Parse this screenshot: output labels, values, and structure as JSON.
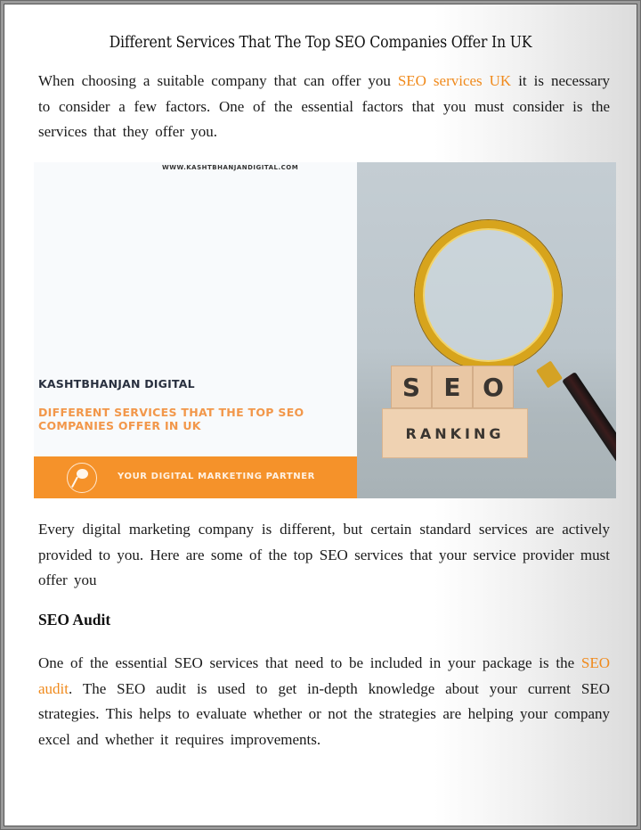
{
  "document": {
    "title": "Different Services That The Top SEO Companies Offer In UK",
    "intro": {
      "before": "When choosing a suitable company that can offer you ",
      "link": "SEO services UK",
      "after": " it is necessary to consider a few factors. One of the essential factors that you must consider is the services that they offer you."
    },
    "paragraph2": "Every digital marketing company is different, but certain standard services are actively provided to you. Here are some of the top SEO services that your service provider must offer you",
    "section_heading": "SEO Audit",
    "paragraph3": {
      "before": "One of the essential SEO services that need to be included in your package is the ",
      "link": "SEO audit",
      "after": ". The SEO audit is used to get in-depth knowledge about your current SEO strategies. This helps to evaluate whether or not the strategies are helping your company excel and whether it requires improvements."
    }
  },
  "banner": {
    "site_url": "WWW.KASHTBHANJANDIGITAL.COM",
    "brand": "KASHTBHANJAN DIGITAL",
    "headline": "DIFFERENT SERVICES THAT THE TOP SEO COMPANIES OFFER IN UK",
    "tagline": "YOUR DIGITAL MARKETING PARTNER",
    "blocks": [
      "S",
      "E",
      "O"
    ],
    "ranking_label": "RANKING",
    "icon": "pin-icon"
  },
  "colors": {
    "link": "#f08a1c",
    "banner_orange": "#f5922a",
    "headline_orange": "#f2974a",
    "brand_navy": "#2a3140"
  }
}
